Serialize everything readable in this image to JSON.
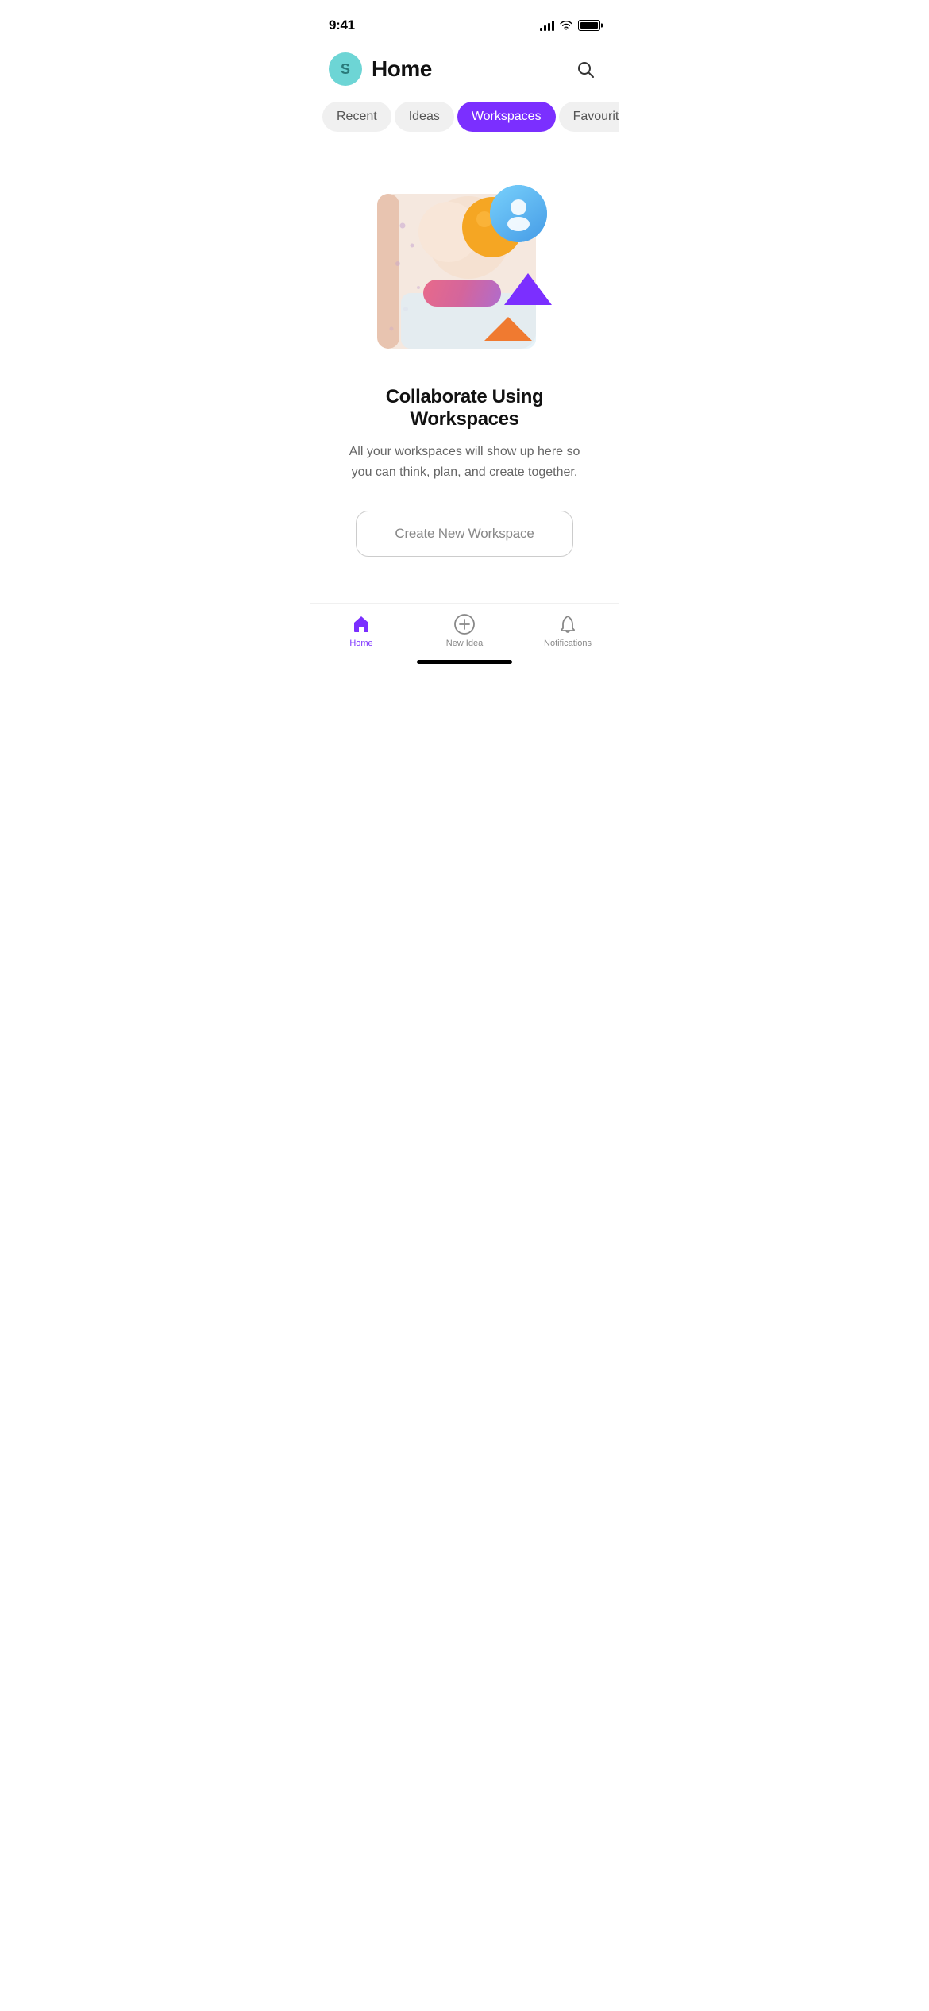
{
  "statusBar": {
    "time": "9:41"
  },
  "header": {
    "avatarLetter": "S",
    "title": "Home"
  },
  "tabs": [
    {
      "id": "recent",
      "label": "Recent",
      "active": false
    },
    {
      "id": "ideas",
      "label": "Ideas",
      "active": false
    },
    {
      "id": "workspaces",
      "label": "Workspaces",
      "active": true
    },
    {
      "id": "favourites",
      "label": "Favourites",
      "active": false
    }
  ],
  "mainContent": {
    "title": "Collaborate Using Workspaces",
    "subtitle": "All your workspaces will show up here so you can think, plan, and create together.",
    "createButton": "Create New Workspace"
  },
  "bottomNav": [
    {
      "id": "home",
      "label": "Home",
      "active": true
    },
    {
      "id": "new-idea",
      "label": "New Idea",
      "active": false
    },
    {
      "id": "notifications",
      "label": "Notifications",
      "active": false
    }
  ],
  "colors": {
    "accent": "#7b2fff",
    "tabActive": "#7b2fff",
    "tabInactive": "#f0f0f0"
  }
}
